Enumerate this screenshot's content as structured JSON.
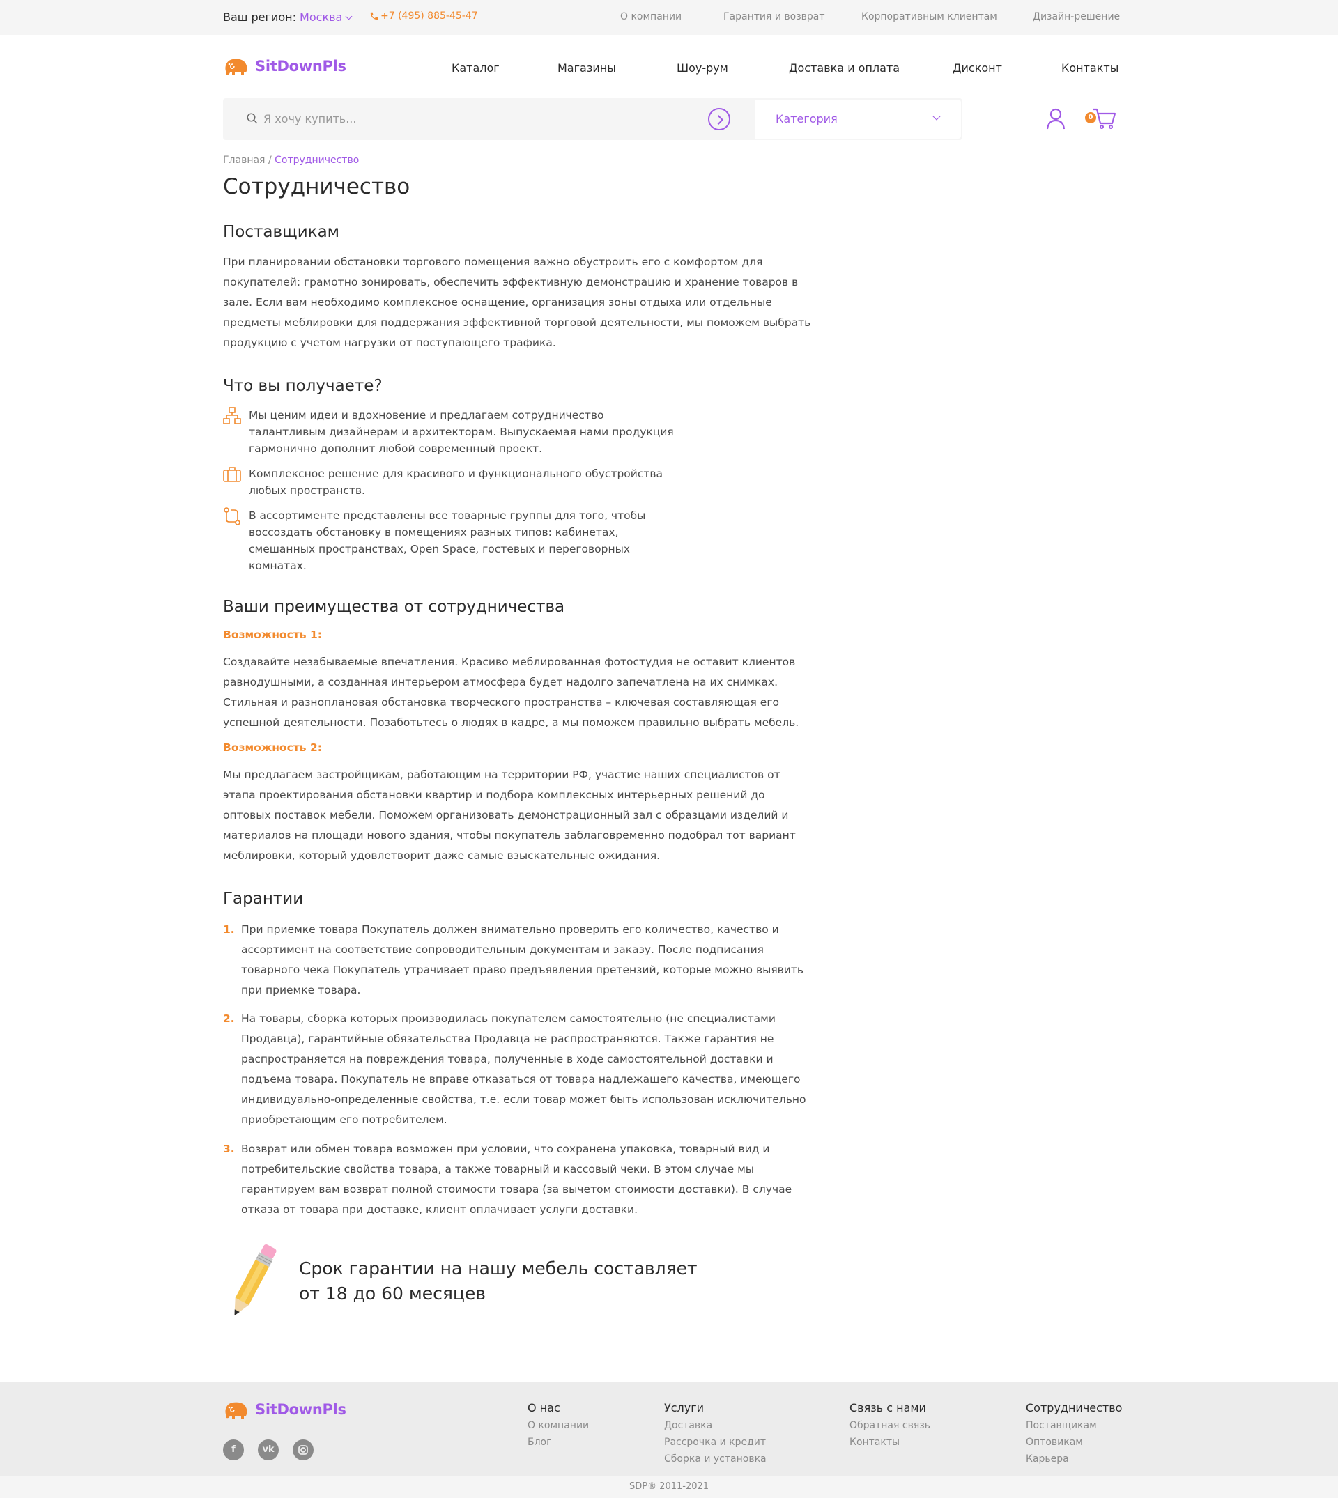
{
  "topbar": {
    "region_label": "Ваш регион:",
    "region_city": "Москва",
    "phone": "+7 (495) 885-45-47",
    "links": [
      "О компании",
      "Гарантия и возврат",
      "Корпоративным клиентам",
      "Дизайн-решение"
    ]
  },
  "brand": {
    "name": "SitDownPls",
    "accent": "#a05ae6",
    "orange": "#f28a2e"
  },
  "nav": [
    "Каталог",
    "Магазины",
    "Шоу-рум",
    "Доставка и оплата",
    "Дисконт",
    "Контакты"
  ],
  "search": {
    "placeholder": "Я хочу купить...",
    "category": "Категория"
  },
  "cart": {
    "count": "0"
  },
  "breadcrumb": {
    "home": "Главная",
    "separator": "/",
    "current": "Сотрудничество"
  },
  "page_title": "Сотрудничество",
  "suppliers": {
    "heading": "Поставщикам",
    "text": "При планировании обстановки торгового помещения важно обустроить его с комфортом для покупателей: грамотно зонировать, обеспечить эффективную демонстрацию и хранение товаров в зале. Если вам необходимо комплексное оснащение, организация зоны отдыха или отдельные предметы меблировки для поддержания эффективной торговой деятельности, мы поможем выбрать продукцию с учетом нагрузки от поступающего трафика."
  },
  "benefits": {
    "heading": "Что вы получаете?",
    "items": [
      {
        "icon": "hierarchy-icon",
        "text": "Мы ценим идеи и вдохновение и предлагаем сотрудничество талантливым дизайнерам и архитекторам. Выпускаемая нами продукция гармонично дополнит любой современный проект."
      },
      {
        "icon": "briefcase-icon",
        "text": "Комплексное решение для красивого и функционального обустройства любых пространств."
      },
      {
        "icon": "route-icon",
        "text": "В ассортименте представлены все товарные группы для того, чтобы воссоздать обстановку в помещениях разных типов: кабинетах, смешанных пространствах, Open Space, гостевых и переговорных комнатах."
      }
    ]
  },
  "advantages": {
    "heading": "Ваши преимущества от сотрудничества",
    "items": [
      {
        "label": "Возможность 1:",
        "text": "Создавайте незабываемые впечатления. Красиво меблированная фотостудия не оставит клиентов равнодушными, а созданная интерьером атмосфера будет надолго запечатлена на их снимках. Стильная и разноплановая обстановка творческого пространства – ключевая составляющая его успешной деятельности. Позаботьтесь о людях в кадре, а мы поможем правильно выбрать мебель."
      },
      {
        "label": "Возможность 2:",
        "text": "Мы предлагаем застройщикам, работающим на территории РФ, участие наших специалистов от этапа проектирования обстановки квартир и подбора комплексных интерьерных решений до оптовых поставок мебели. Поможем организовать демонстрационный зал с образцами изделий и материалов на площади нового здания, чтобы покупатель заблаговременно подобрал тот вариант меблировки, который удовлетворит даже самые взыскательные ожидания."
      }
    ]
  },
  "guarantees": {
    "heading": "Гарантии",
    "items": [
      {
        "num": "1.",
        "text": "При приемке товара Покупатель должен внимательно проверить его количество, качество и ассортимент на соответствие сопроводительным документам и заказу. После подписания товарного чека Покупатель утрачивает право предъявления претензий, которые можно выявить при приемке товара."
      },
      {
        "num": "2.",
        "text": "На товары, сборка которых производилась покупателем самостоятельно (не специалистами Продавца), гарантийные обязательства Продавца не распространяются. Также гарантия не распространяется на повреждения товара, полученные в ходе самостоятельной доставки и подъема товара. Покупатель не вправе отказаться от товара надлежащего качества, имеющего индивидуально-определенные свойства, т.е. если товар может быть использован исключительно приобретающим его потребителем."
      },
      {
        "num": "3.",
        "text": "Возврат или обмен товара возможен при условии, что сохранена упаковка, товарный вид и потребительские свойства товара, а также товарный и кассовый чеки. В этом случае мы гарантируем вам возврат полной стоимости товара (за вычетом стоимости доставки). В случае отказа от товара при доставке, клиент оплачивает услуги доставки."
      }
    ],
    "warranty_line1": "Срок гарантии на нашу мебель составляет",
    "warranty_line2": "от 18 до 60 месяцев"
  },
  "footer": {
    "columns": [
      {
        "heading": "О нас",
        "links": [
          "О компании",
          "Блог"
        ]
      },
      {
        "heading": "Услуги",
        "links": [
          "Доставка",
          "Рассрочка и кредит",
          "Сборка и установка"
        ]
      },
      {
        "heading": "Связь с нами",
        "links": [
          "Обратная связь",
          "Контакты"
        ]
      },
      {
        "heading": "Сотрудничество",
        "links": [
          "Поставщикам",
          "Оптовикам",
          "Карьера"
        ]
      }
    ],
    "social": [
      "facebook-icon",
      "vk-icon",
      "instagram-icon"
    ],
    "copyright": "SDP®   2011-2021"
  }
}
